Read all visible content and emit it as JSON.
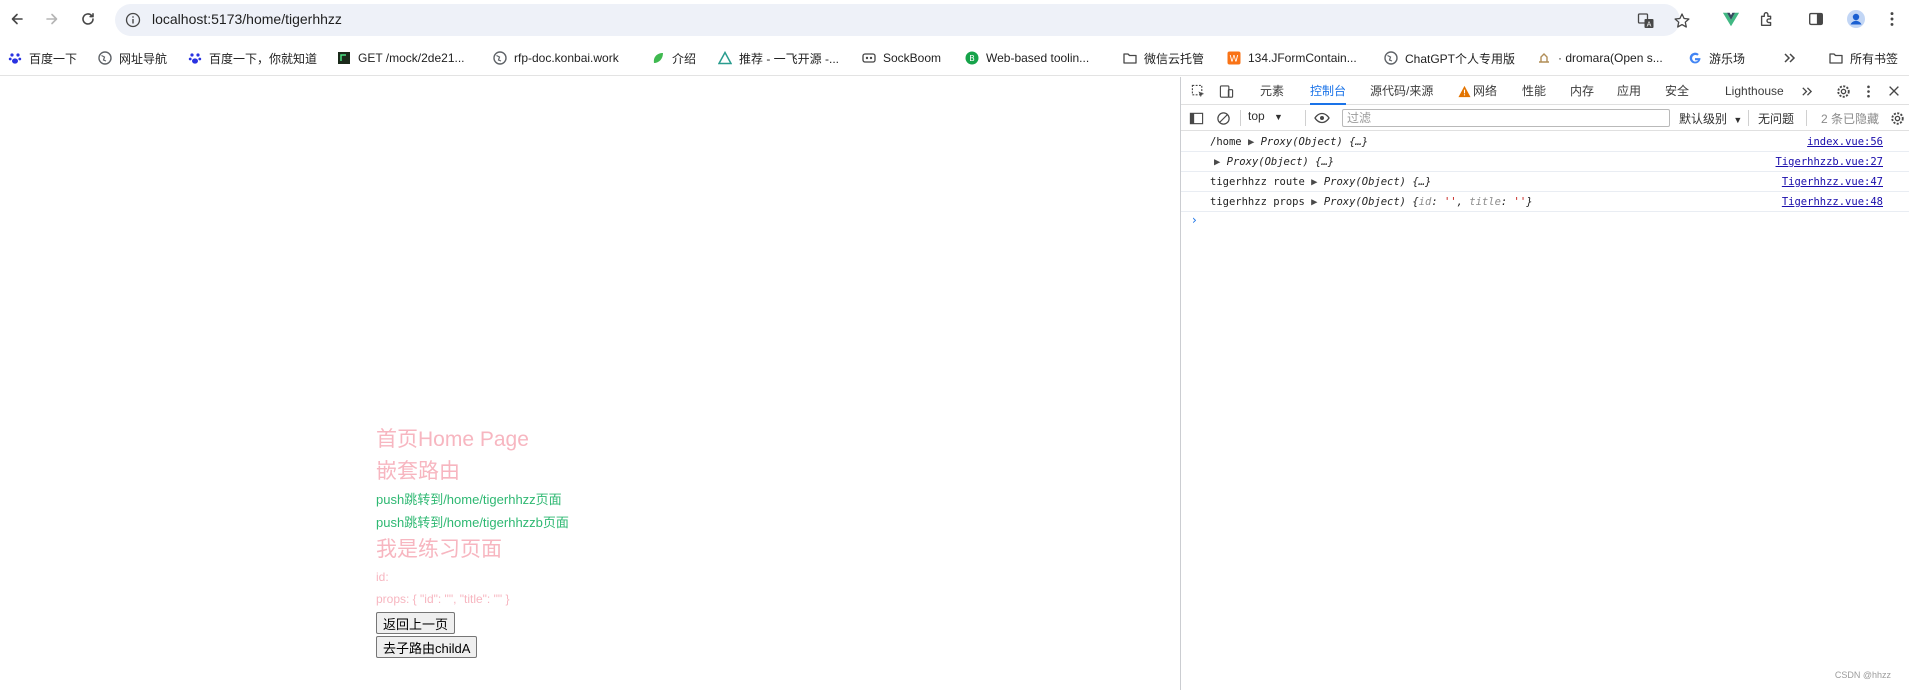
{
  "browser": {
    "url": "localhost:5173/home/tigerhhzz",
    "bookmarks": [
      "百度一下",
      "网址导航",
      "百度一下，你就知道",
      "GET /mock/2de21...",
      "rfp-doc.konbai.work",
      "介绍",
      "推荐 - 一飞开源 -...",
      "SockBoom",
      "Web-based toolin...",
      "微信云托管",
      "134.JFormContain...",
      "ChatGPT个人专用版",
      "· dromara(Open s...",
      "游乐场"
    ],
    "all_bookmarks_label": "所有书签"
  },
  "page": {
    "home_title": "首页Home Page",
    "nested_title": "嵌套路由",
    "push_link_1": "push跳转到/home/tigerhhzz页面",
    "push_link_2": "push跳转到/home/tigerhhzzb页面",
    "practice_title": "我是练习页面",
    "id_line": "id:",
    "props_line": "props: { \"id\": \"\", \"title\": \"\" }",
    "back_button": "返回上一页",
    "child_button": "去子路由childA"
  },
  "devtools": {
    "tabs": [
      "元素",
      "控制台",
      "源代码/来源",
      "网络",
      "性能",
      "内存",
      "应用",
      "安全",
      "Lighthouse"
    ],
    "active_tab": "控制台",
    "context": "top",
    "filter_placeholder": "过滤",
    "level": "默认级别",
    "issues": "无问题",
    "hidden": "2 条已隐藏",
    "logs": [
      {
        "prefix": "/home",
        "obj": "Proxy(Object) {…}",
        "source": "index.vue:56"
      },
      {
        "prefix": "",
        "obj": "Proxy(Object) {…}",
        "source": "Tigerhhzzb.vue:27"
      },
      {
        "prefix": "tigerhhzz route",
        "obj": "Proxy(Object) {…}",
        "source": "Tigerhhzz.vue:47"
      },
      {
        "prefix": "tigerhhzz props",
        "obj": "Proxy(Object)",
        "source": "Tigerhhzz.vue:48"
      }
    ],
    "props_id_key": "id",
    "props_title_key": "title",
    "props_empty": "''"
  },
  "watermark": "CSDN @hhzz",
  "colors": {
    "pink": "#f7b6c0",
    "green": "#2eb872",
    "devtools_accent": "#1a73e8"
  }
}
